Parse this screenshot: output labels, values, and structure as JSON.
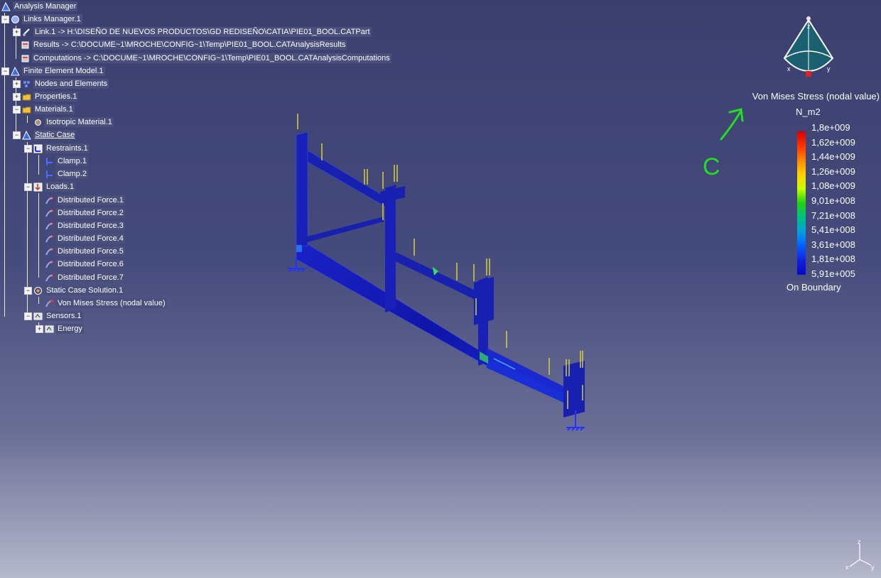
{
  "tree": {
    "items": [
      {
        "label": "Analysis Manager",
        "icon": "analysis-manager-icon",
        "exp": ""
      },
      {
        "label": "Links Manager.1",
        "icon": "links-manager-icon",
        "exp": "−"
      },
      {
        "label": "Link.1 -> H:\\DISEÑO DE NUEVOS PRODUCTOS\\GD REDISEÑO\\CATIA\\PIE01_BOOL.CATPart",
        "icon": "link-icon",
        "exp": "+"
      },
      {
        "label": "Results -> C:\\DOCUME~1\\MROCHE\\CONFIG~1\\Temp\\PIE01_BOOL.CATAnalysisResults",
        "icon": "results-file-icon",
        "exp": ""
      },
      {
        "label": "Computations -> C:\\DOCUME~1\\MROCHE\\CONFIG~1\\Temp\\PIE01_BOOL.CATAnalysisComputations",
        "icon": "computations-file-icon",
        "exp": ""
      },
      {
        "label": "Finite Element Model.1",
        "icon": "fem-icon",
        "exp": "−"
      },
      {
        "label": "Nodes and Elements",
        "icon": "nodes-elements-icon",
        "exp": "+"
      },
      {
        "label": "Properties.1",
        "icon": "properties-folder-icon",
        "exp": "+"
      },
      {
        "label": "Materials.1",
        "icon": "materials-folder-icon",
        "exp": "−"
      },
      {
        "label": "Isotropic Material.1",
        "icon": "material-icon",
        "exp": ""
      },
      {
        "label": "Static Case",
        "icon": "static-case-icon",
        "exp": "−"
      },
      {
        "label": "Restraints.1",
        "icon": "restraints-icon",
        "exp": "−"
      },
      {
        "label": "Clamp.1",
        "icon": "clamp-icon",
        "exp": ""
      },
      {
        "label": "Clamp.2",
        "icon": "clamp-icon",
        "exp": ""
      },
      {
        "label": "Loads.1",
        "icon": "loads-icon",
        "exp": "−"
      },
      {
        "label": "Distributed Force.1",
        "icon": "distributed-force-icon",
        "exp": ""
      },
      {
        "label": "Distributed Force.2",
        "icon": "distributed-force-icon",
        "exp": ""
      },
      {
        "label": "Distributed Force.3",
        "icon": "distributed-force-icon",
        "exp": ""
      },
      {
        "label": "Distributed Force.4",
        "icon": "distributed-force-icon",
        "exp": ""
      },
      {
        "label": "Distributed Force.5",
        "icon": "distributed-force-icon",
        "exp": ""
      },
      {
        "label": "Distributed Force.6",
        "icon": "distributed-force-icon",
        "exp": ""
      },
      {
        "label": "Distributed Force.7",
        "icon": "distributed-force-icon",
        "exp": ""
      },
      {
        "label": "Static Case Solution.1",
        "icon": "solution-icon",
        "exp": "−"
      },
      {
        "label": "Von Mises Stress (nodal value)",
        "icon": "von-mises-image-icon",
        "exp": ""
      },
      {
        "label": "Sensors.1",
        "icon": "sensors-icon",
        "exp": "−"
      },
      {
        "label": "Energy",
        "icon": "energy-sensor-icon",
        "exp": "+"
      }
    ]
  },
  "legend": {
    "title": "Von Mises Stress (nodal value)",
    "unit": "N_m2",
    "values": [
      "1,8e+009",
      "1,62e+009",
      "1,44e+009",
      "1,26e+009",
      "1,08e+009",
      "9,01e+008",
      "7,21e+008",
      "5,41e+008",
      "3,61e+008",
      "1,81e+008",
      "5,91e+005"
    ],
    "footer": "On Boundary"
  },
  "annotation": {
    "letter": "C",
    "color": "#22dd22"
  },
  "compass": {
    "labels": [
      "z",
      "x",
      "y"
    ]
  },
  "axis": {
    "labels": [
      "z",
      "x",
      "y"
    ]
  },
  "colors": {
    "background": "#3a3f6e",
    "mesh": "#1a1ab0",
    "load_arrow": "#d8d040",
    "clamp": "#2233ff"
  }
}
